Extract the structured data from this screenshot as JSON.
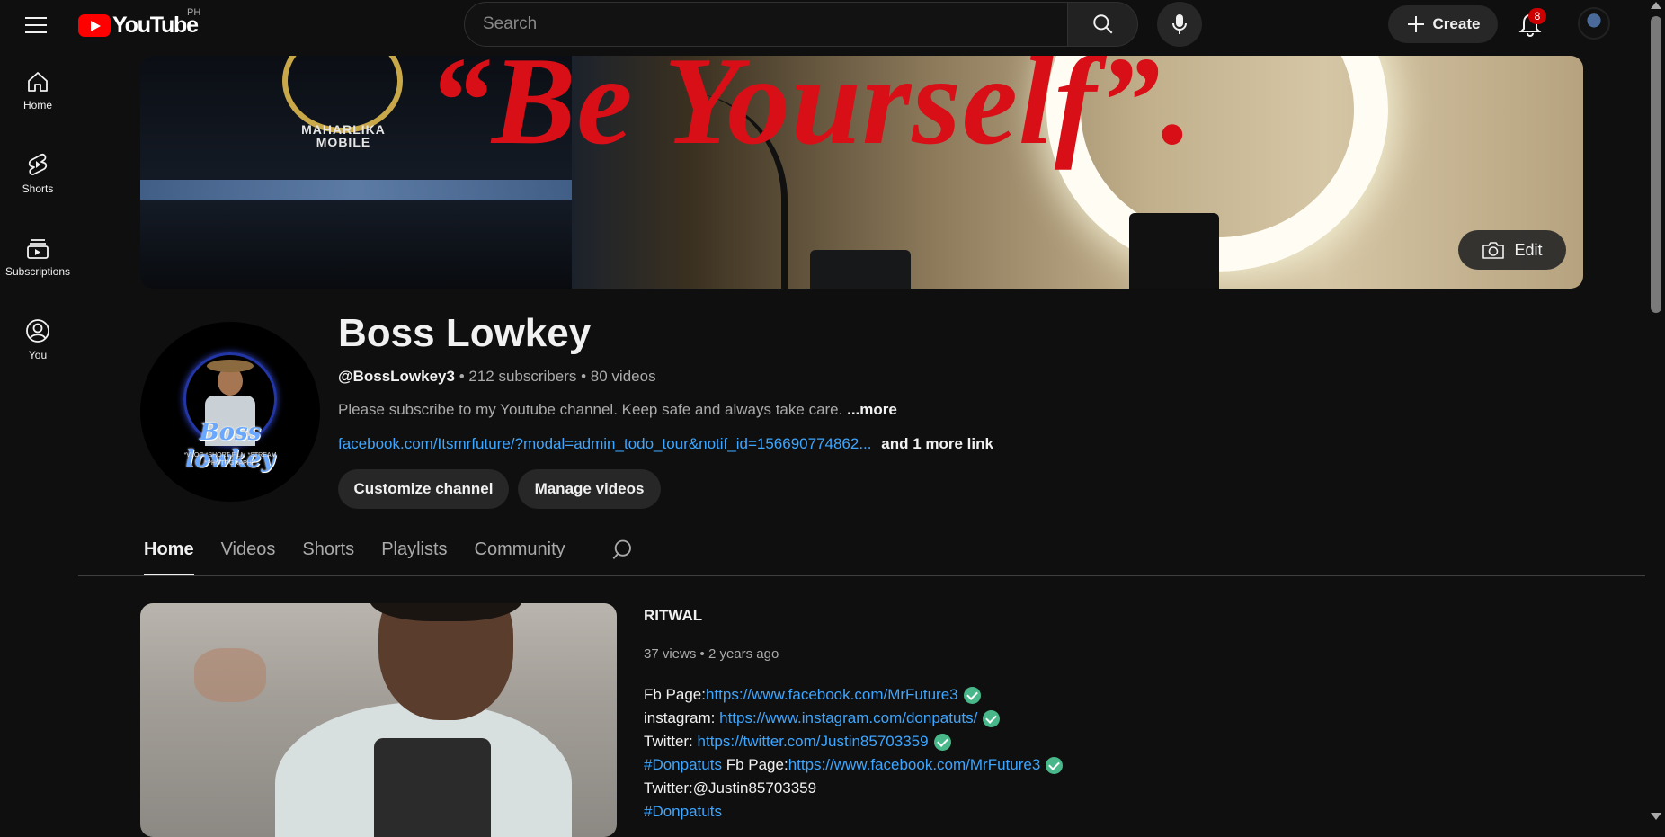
{
  "header": {
    "logo_text": "YouTube",
    "country_code": "PH",
    "search_placeholder": "Search",
    "create_label": "Create",
    "notification_count": "8",
    "icons": {
      "menu": "menu-icon",
      "search": "search-icon",
      "mic": "microphone-icon",
      "create": "plus-icon",
      "notifications": "bell-icon"
    }
  },
  "sidebar": {
    "items": [
      {
        "label": "Home",
        "icon": "home-icon"
      },
      {
        "label": "Shorts",
        "icon": "shorts-icon"
      },
      {
        "label": "Subscriptions",
        "icon": "subscriptions-icon"
      },
      {
        "label": "You",
        "icon": "account-icon"
      }
    ]
  },
  "banner": {
    "quote": "“Be Yourself”.",
    "emblem_text": "MAHARLIKA MOBILE",
    "edit_label": "Edit",
    "quote_color": "#d80f17"
  },
  "channel": {
    "name": "Boss Lowkey",
    "handle": "@BossLowkey3",
    "subscribers": "212 subscribers",
    "videos": "80 videos",
    "separator": " • ",
    "description": "Please subscribe to my Youtube channel. Keep safe and always take care.",
    "more_label": "...more",
    "link": "facebook.com/Itsmrfuture/?modal=admin_todo_tour&notif_id=156690774862...",
    "more_links": "and 1 more link",
    "avatar_script": "Boss lowkey",
    "avatar_subtitle": "*VLOG *SHORT FILM *STREAM *PHOTOGRAPHY",
    "customize_label": "Customize channel",
    "manage_label": "Manage videos"
  },
  "tabs": [
    {
      "label": "Home",
      "active": true
    },
    {
      "label": "Videos",
      "active": false
    },
    {
      "label": "Shorts",
      "active": false
    },
    {
      "label": "Playlists",
      "active": false
    },
    {
      "label": "Community",
      "active": false
    }
  ],
  "featured_video": {
    "title": "RITWAL",
    "views": "37 views",
    "age": "2 years ago",
    "meta_separator": " • ",
    "description": {
      "line1_prefix": "Fb Page:",
      "line1_link": "https://www.facebook.com/MrFuture3",
      "line2_prefix": "instagram: ",
      "line2_link": "https://www.instagram.com/donpatuts/",
      "line3_prefix": "Twitter: ",
      "line3_link": "https://twitter.com/Justin85703359",
      "line4_hashtag": "#Donpatuts",
      "line4_prefix": " Fb Page:",
      "line4_link": "https://www.facebook.com/MrFuture3",
      "line5": "Twitter:@Justin85703359",
      "line6_hashtag": "#Donpatuts"
    }
  },
  "colors": {
    "background": "#0f0f0f",
    "link": "#3ea6ff",
    "brand_red": "#ff0000",
    "verified_check": "#48b88a"
  }
}
